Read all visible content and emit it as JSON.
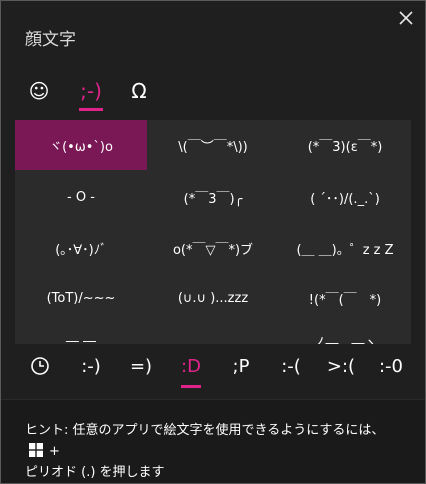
{
  "window": {
    "title": "顔文字"
  },
  "tabs": [
    {
      "label": "☺",
      "icon": "smiley-icon"
    },
    {
      "label": ";-)",
      "icon": "kaomoji-icon"
    },
    {
      "label": "Ω",
      "icon": "omega-symbol-icon"
    }
  ],
  "kaomoji_grid": [
    "ヾ(•ω•`)o",
    "\\(￣︶￣*\\))",
    "(*￣3)(ε￣*)",
    "- O -",
    "(*￣3￣)╭",
    "( ´･･)/(._.`)",
    "(｡･∀･)ﾉﾞ",
    "o(*￣▽￣*)ブ",
    "(＿ ＿)。゜z z Z",
    "(ToT)/~~~",
    "(∪.∪ )...zzz",
    "!(*￣(￣　*)",
    "―  ―",
    "",
    "ノ―　―ヽ"
  ],
  "categories": [
    {
      "label": "",
      "icon": "clock-icon"
    },
    {
      "label": ":-)"
    },
    {
      "label": "=)"
    },
    {
      "label": ":D"
    },
    {
      "label": ";P"
    },
    {
      "label": ":-("
    },
    {
      "label": ">:("
    },
    {
      "label": ":-0"
    }
  ],
  "hint": {
    "line1": "ヒント: 任意のアプリで絵文字を使用できるようにするには、",
    "plus": "+",
    "line2": "ピリオド (.) を押します"
  },
  "colors": {
    "accent": "#e0238a",
    "selected_bg": "#7a1855",
    "panel_bg": "#1f1f1f",
    "grid_bg": "#2b2b2b"
  }
}
